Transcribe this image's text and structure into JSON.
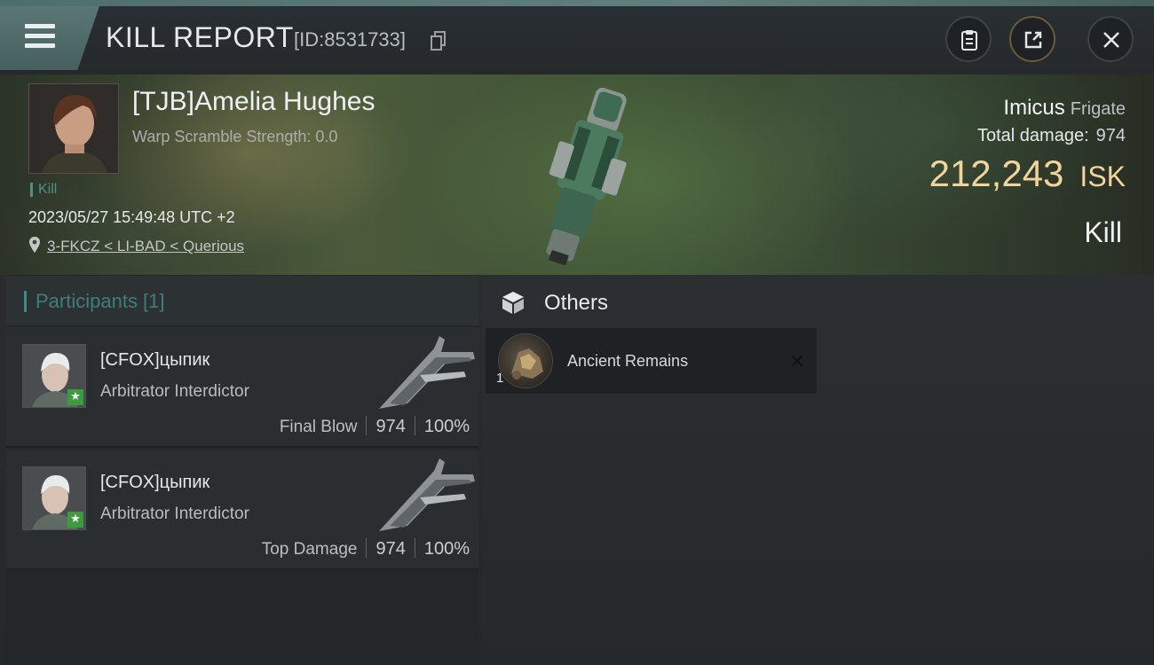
{
  "header": {
    "title": "KILL REPORT",
    "report_id": "[ID:8531733]",
    "icons": [
      "menu-icon",
      "copy-icon",
      "clipboard-icon",
      "share-icon",
      "close-icon"
    ]
  },
  "victim": {
    "name": "[TJB]Amelia Hughes",
    "warp_scramble": "Warp Scramble Strength: 0.0",
    "tag": "Kill",
    "datetime": "2023/05/27 15:49:48 UTC +2",
    "location": "3-FKCZ < LI-BAD < Querious"
  },
  "ship": {
    "name": "Imicus",
    "class": "Frigate",
    "total_damage_label": "Total damage:",
    "total_damage": "974",
    "isk_value": "212,243",
    "isk_unit": "ISK",
    "result": "Kill"
  },
  "participants": {
    "header": "Participants [1]",
    "rows": [
      {
        "name": "[CFOX]цыпик",
        "ship": "Arbitrator Interdictor",
        "label": "Final Blow",
        "damage": "974",
        "percent": "100%"
      },
      {
        "name": "[CFOX]цыпик",
        "ship": "Arbitrator Interdictor",
        "label": "Top Damage",
        "damage": "974",
        "percent": "100%"
      }
    ]
  },
  "others": {
    "title": "Others",
    "items": [
      {
        "quantity": "1",
        "name": "Ancient Remains",
        "status": "destroyed"
      }
    ]
  },
  "colors": {
    "accent_teal": "#3f8c86",
    "isk_gold": "#f0d49a",
    "star_green": "#3b9c3b"
  }
}
